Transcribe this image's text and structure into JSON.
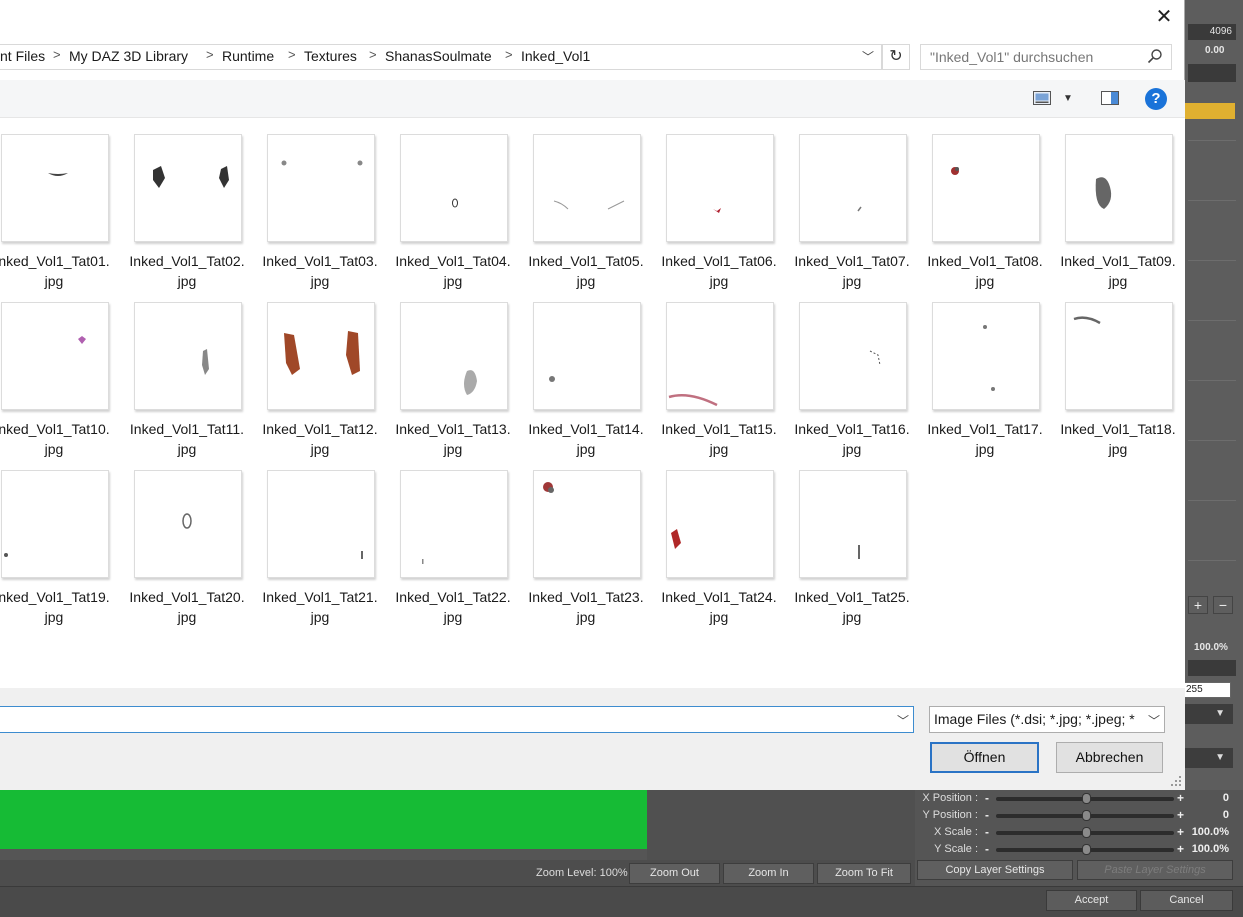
{
  "background_app": {
    "right_panel": {
      "value_top": "4096",
      "value_second": "0.00",
      "percent": "100.0%",
      "input_value": "255"
    },
    "zoom": {
      "label": "Zoom Level: 100%",
      "zoom_out": "Zoom Out",
      "zoom_in": "Zoom In",
      "zoom_to_fit": "Zoom To Fit"
    },
    "layer": {
      "x_position_label": "X Position :",
      "x_position_value": "0",
      "y_position_label": "Y Position :",
      "y_position_value": "0",
      "x_scale_label": "X Scale :",
      "x_scale_value": "100.0%",
      "y_scale_label": "Y Scale :",
      "y_scale_value": "100.0%",
      "copy_settings": "Copy Layer Settings",
      "paste_settings": "Paste Layer Settings"
    },
    "footer": {
      "accept": "Accept",
      "cancel": "Cancel"
    },
    "colors": {
      "canvas_green": "#16bb35",
      "highlight": "#e0b030"
    }
  },
  "dialog": {
    "breadcrumb": [
      "nt Files",
      "My DAZ 3D Library",
      "Runtime",
      "Textures",
      "ShanasSoulmate",
      "Inked_Vol1"
    ],
    "search_placeholder": "\"Inked_Vol1\" durchsuchen",
    "files": [
      {
        "name1": "nked_Vol1_Tat01.",
        "name2": "jpg"
      },
      {
        "name1": "Inked_Vol1_Tat02.",
        "name2": "jpg"
      },
      {
        "name1": "Inked_Vol1_Tat03.",
        "name2": "jpg"
      },
      {
        "name1": "Inked_Vol1_Tat04.",
        "name2": "jpg"
      },
      {
        "name1": "Inked_Vol1_Tat05.",
        "name2": "jpg"
      },
      {
        "name1": "Inked_Vol1_Tat06.",
        "name2": "jpg"
      },
      {
        "name1": "Inked_Vol1_Tat07.",
        "name2": "jpg"
      },
      {
        "name1": "Inked_Vol1_Tat08.",
        "name2": "jpg"
      },
      {
        "name1": "Inked_Vol1_Tat09.",
        "name2": "jpg"
      },
      {
        "name1": "nked_Vol1_Tat10.",
        "name2": "jpg"
      },
      {
        "name1": "Inked_Vol1_Tat11.",
        "name2": "jpg"
      },
      {
        "name1": "Inked_Vol1_Tat12.",
        "name2": "jpg"
      },
      {
        "name1": "Inked_Vol1_Tat13.",
        "name2": "jpg"
      },
      {
        "name1": "Inked_Vol1_Tat14.",
        "name2": "jpg"
      },
      {
        "name1": "Inked_Vol1_Tat15.",
        "name2": "jpg"
      },
      {
        "name1": "Inked_Vol1_Tat16.",
        "name2": "jpg"
      },
      {
        "name1": "Inked_Vol1_Tat17.",
        "name2": "jpg"
      },
      {
        "name1": "Inked_Vol1_Tat18.",
        "name2": "jpg"
      },
      {
        "name1": "nked_Vol1_Tat19.",
        "name2": "jpg"
      },
      {
        "name1": "Inked_Vol1_Tat20.",
        "name2": "jpg"
      },
      {
        "name1": "Inked_Vol1_Tat21.",
        "name2": "jpg"
      },
      {
        "name1": "Inked_Vol1_Tat22.",
        "name2": "jpg"
      },
      {
        "name1": "Inked_Vol1_Tat23.",
        "name2": "jpg"
      },
      {
        "name1": "Inked_Vol1_Tat24.",
        "name2": "jpg"
      },
      {
        "name1": "Inked_Vol1_Tat25.",
        "name2": "jpg"
      }
    ],
    "filename_value": "",
    "filetype_selected": "Image Files (*.dsi; *.jpg; *.jpeg; *",
    "open_label": "Öffnen",
    "cancel_label": "Abbrechen",
    "colors": {
      "accent": "#1a73d9",
      "focus_border": "#2a73c5"
    }
  }
}
